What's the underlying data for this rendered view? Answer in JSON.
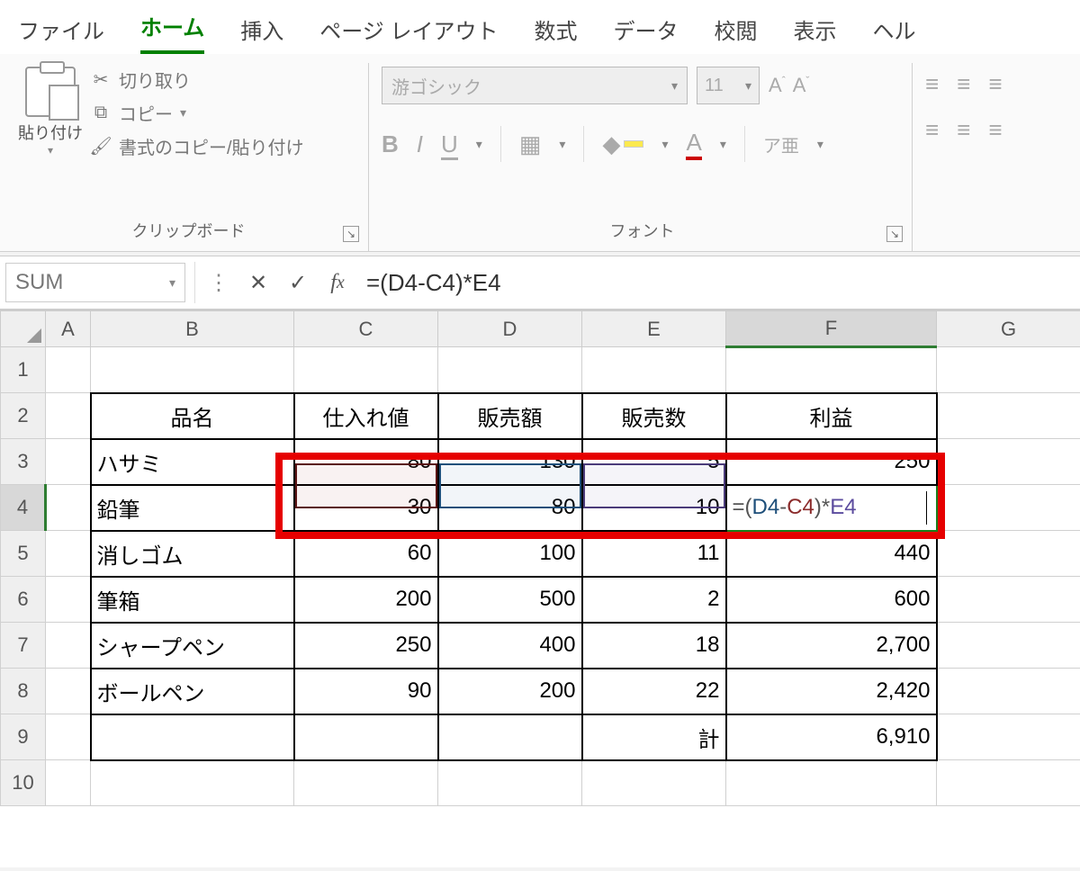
{
  "tabs": {
    "file": "ファイル",
    "home": "ホーム",
    "insert": "挿入",
    "layout": "ページ レイアウト",
    "formulas": "数式",
    "data": "データ",
    "review": "校閲",
    "view": "表示",
    "help": "ヘル"
  },
  "clipboard": {
    "paste": "貼り付け",
    "cut": "切り取り",
    "copy": "コピー",
    "format": "書式のコピー/貼り付け",
    "group_label": "クリップボード"
  },
  "font": {
    "family": "游ゴシック",
    "size": "11",
    "group_label": "フォント",
    "bold": "B",
    "italic": "I",
    "underline": "U",
    "phonetic": "ア亜"
  },
  "align": {
    "top": "⟝",
    "mid": "≡",
    "bot": "⟞"
  },
  "fbar": {
    "name": "SUM",
    "formula": "=(D4-C4)*E4"
  },
  "columns": [
    "A",
    "B",
    "C",
    "D",
    "E",
    "F",
    "G"
  ],
  "rows": [
    "1",
    "2",
    "3",
    "4",
    "5",
    "6",
    "7",
    "8",
    "9",
    "10"
  ],
  "table": {
    "h_b": "品名",
    "h_c": "仕入れ値",
    "h_d": "販売額",
    "h_e": "販売数",
    "h_f": "利益",
    "r3": {
      "b": "ハサミ",
      "c": "80",
      "d": "130",
      "e": "5",
      "f": "250"
    },
    "r4": {
      "b": "鉛筆",
      "c": "30",
      "d": "80",
      "e": "10",
      "f": "=(D4-C4)*E4"
    },
    "r5": {
      "b": "消しゴム",
      "c": "60",
      "d": "100",
      "e": "11",
      "f": "440"
    },
    "r6": {
      "b": "筆箱",
      "c": "200",
      "d": "500",
      "e": "2",
      "f": "600"
    },
    "r7": {
      "b": "シャープペン",
      "c": "250",
      "d": "400",
      "e": "18",
      "f": "2,700"
    },
    "r8": {
      "b": "ボールペン",
      "c": "90",
      "d": "200",
      "e": "22",
      "f": "2,420"
    },
    "r9": {
      "e": "計",
      "f": "6,910"
    }
  },
  "chart_data": {
    "type": "table",
    "columns": [
      "品名",
      "仕入れ値",
      "販売額",
      "販売数",
      "利益"
    ],
    "rows": [
      {
        "品名": "ハサミ",
        "仕入れ値": 80,
        "販売額": 130,
        "販売数": 5,
        "利益": 250
      },
      {
        "品名": "鉛筆",
        "仕入れ値": 30,
        "販売額": 80,
        "販売数": 10,
        "利益": "=(D4-C4)*E4"
      },
      {
        "品名": "消しゴム",
        "仕入れ値": 60,
        "販売額": 100,
        "販売数": 11,
        "利益": 440
      },
      {
        "品名": "筆箱",
        "仕入れ値": 200,
        "販売額": 500,
        "販売数": 2,
        "利益": 600
      },
      {
        "品名": "シャープペン",
        "仕入れ値": 250,
        "販売額": 400,
        "販売数": 18,
        "利益": 2700
      },
      {
        "品名": "ボールペン",
        "仕入れ値": 90,
        "販売額": 200,
        "販売数": 22,
        "利益": 2420
      }
    ],
    "totals": {
      "label": "計",
      "利益": 6910
    }
  }
}
